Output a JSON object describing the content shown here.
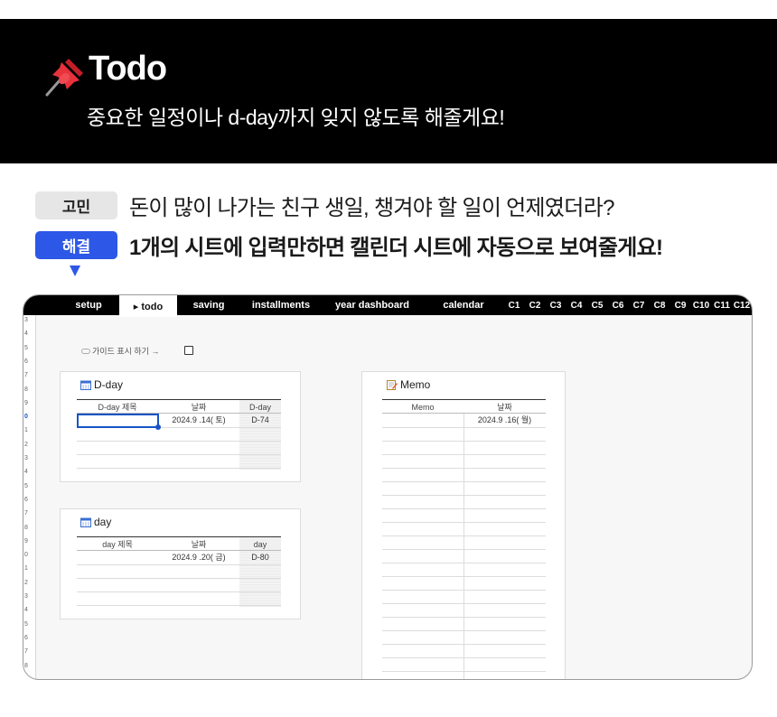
{
  "header": {
    "pin_icon": "pushpin-icon",
    "title": "Todo",
    "subtitle": "중요한 일정이나 d-day까지 잊지 않도록 해줄게요!"
  },
  "problem": {
    "badge": "고민",
    "text": "돈이 많이 나가는 친구 생일, 챙겨야 할 일이 언제였더라?"
  },
  "solution": {
    "badge": "해결",
    "text": "1개의 시트에 입력만하면 캘린더 시트에 자동으로 보여줄게요!",
    "color": "#2d57e6"
  },
  "sheet": {
    "tabs": [
      "setup",
      "▸ todo",
      "saving",
      "installments",
      "year dashboard",
      "calendar",
      "C1",
      "C2",
      "C3",
      "C4",
      "C5",
      "C6",
      "C7",
      "C8",
      "C9",
      "C10",
      "C11",
      "C12"
    ],
    "active_tab": "▸ todo",
    "row_numbers": [
      "3",
      "4",
      "5",
      "6",
      "7",
      "8",
      "9",
      "0",
      "1",
      "2",
      "3",
      "4",
      "5",
      "6",
      "7",
      "8",
      "9",
      "0",
      "1",
      "2",
      "3",
      "4",
      "5",
      "6",
      "7",
      "8"
    ],
    "guide_label": "가이드 표시 하기 →",
    "dday_card": {
      "title": "D-day",
      "icon": "calendar-icon",
      "columns": [
        "D-day 제목",
        "날짜",
        "D-day"
      ],
      "rows": [
        {
          "title": "",
          "date": "2024.9 .14( 토)",
          "dday": "D-74"
        }
      ]
    },
    "day_card": {
      "title": "day",
      "icon": "calendar-icon",
      "columns": [
        "day 제목",
        "날짜",
        "day"
      ],
      "rows": [
        {
          "title": "",
          "date": "2024.9 .20( 금)",
          "dday": "D-80"
        }
      ]
    },
    "memo_card": {
      "title": "Memo",
      "icon": "memo-icon",
      "columns": [
        "Memo",
        "날짜"
      ],
      "rows": [
        {
          "memo": "",
          "date": "2024.9 .16( 월)"
        }
      ]
    }
  }
}
